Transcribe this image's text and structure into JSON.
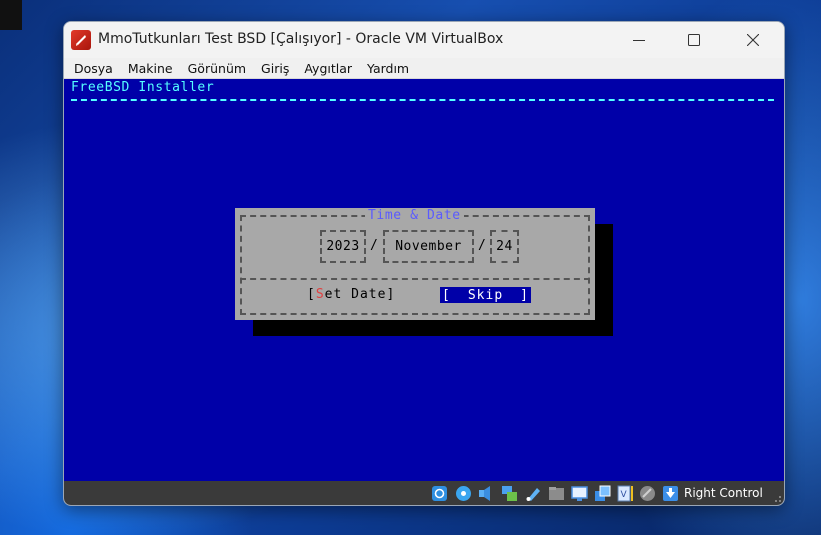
{
  "window": {
    "title": "MmoTutkunları Test BSD [Çalışıyor] - Oracle VM VirtualBox",
    "controls": {
      "minimize": "minimize-icon",
      "maximize": "maximize-icon",
      "close": "close-icon"
    }
  },
  "menu": [
    "Dosya",
    "Makine",
    "Görünüm",
    "Giriş",
    "Aygıtlar",
    "Yardım"
  ],
  "installer": {
    "title": "FreeBSD Installer",
    "dialog": {
      "title": "Time & Date",
      "year": "2023",
      "month": "November",
      "day": "24",
      "separator": "/",
      "set_date": {
        "open": "[",
        "hotkey": "S",
        "rest": "et Date]"
      },
      "skip": {
        "open": "[",
        "label": "Skip",
        "close": "]"
      }
    },
    "colors": {
      "background": "#0000a8",
      "dialog": "#a8a8a8",
      "accent": "#55ffff",
      "hotkey": "#e04040"
    }
  },
  "statusbar": {
    "icons": [
      "hard-disk-icon",
      "optical-disk-icon",
      "audio-icon",
      "network-icon",
      "usb-icon",
      "shared-folder-icon",
      "display-icon",
      "recording-icon",
      "virtualization-icon",
      "mouse-integration-icon",
      "host-key-arrow-icon"
    ],
    "host_key": "Right Control"
  }
}
